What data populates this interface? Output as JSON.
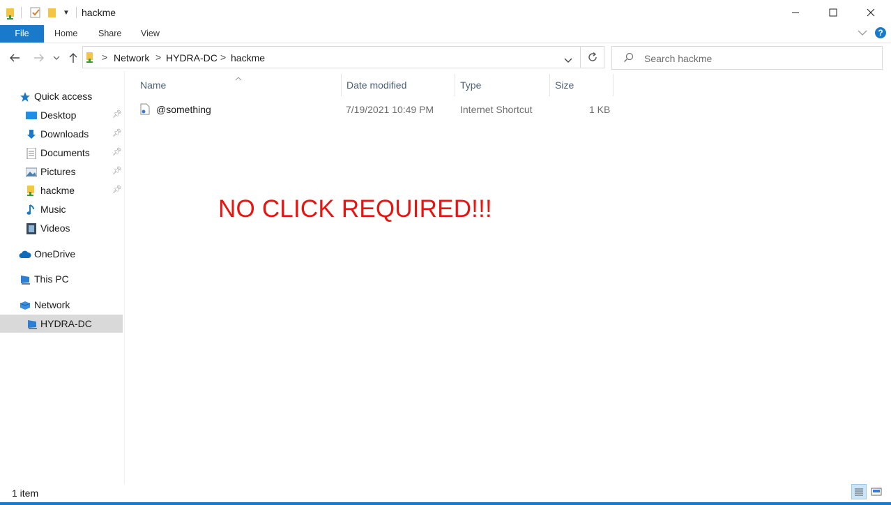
{
  "window": {
    "title": "hackme"
  },
  "ribbon": {
    "file": "File",
    "home": "Home",
    "share": "Share",
    "view": "View"
  },
  "address": {
    "crumbs": [
      "Network",
      "HYDRA-DC",
      "hackme"
    ],
    "separator": ">"
  },
  "search": {
    "placeholder": "Search hackme"
  },
  "nav": {
    "quick_access": "Quick access",
    "items": [
      {
        "label": "Desktop",
        "icon": "desktop-icon",
        "pinned": true
      },
      {
        "label": "Downloads",
        "icon": "downloads-icon",
        "pinned": true
      },
      {
        "label": "Documents",
        "icon": "documents-icon",
        "pinned": true
      },
      {
        "label": "Pictures",
        "icon": "pictures-icon",
        "pinned": true
      },
      {
        "label": "hackme",
        "icon": "folder-icon",
        "pinned": true
      },
      {
        "label": "Music",
        "icon": "music-icon",
        "pinned": false
      },
      {
        "label": "Videos",
        "icon": "videos-icon",
        "pinned": false
      }
    ],
    "onedrive": "OneDrive",
    "this_pc": "This PC",
    "network": "Network",
    "hydra": "HYDRA-DC"
  },
  "columns": {
    "name": "Name",
    "date": "Date modified",
    "type": "Type",
    "size": "Size"
  },
  "files": [
    {
      "name": "@something",
      "date": "7/19/2021 10:49 PM",
      "type": "Internet Shortcut",
      "size": "1 KB"
    }
  ],
  "overlay_text": "NO CLICK REQUIRED!!!",
  "status": {
    "count": "1 item"
  },
  "colors": {
    "accent": "#1979ca",
    "overlay": "#e8140f"
  }
}
